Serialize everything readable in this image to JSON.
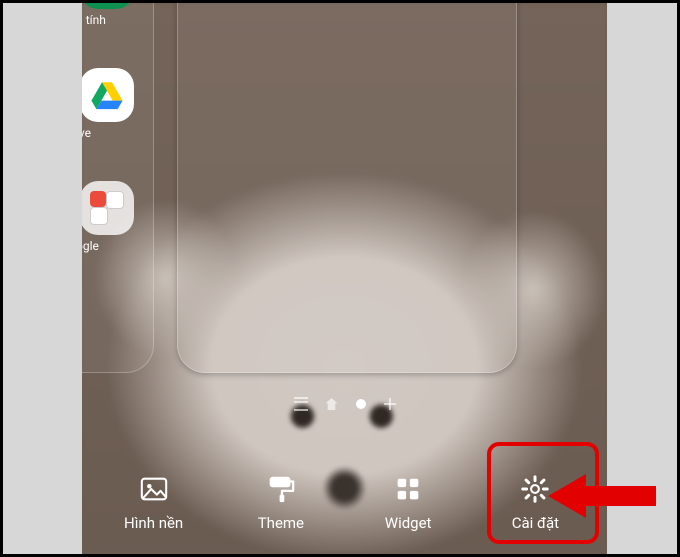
{
  "side_apps": {
    "sheets_label": "g tính",
    "drive_label": "ive",
    "folder_label": "ogle"
  },
  "actions": {
    "wallpaper": "Hình nền",
    "theme": "Theme",
    "widget": "Widget",
    "settings": "Cài đặt"
  },
  "icons": {
    "wallpaper": "image-icon",
    "theme": "paint-roller-icon",
    "widget": "grid-icon",
    "settings": "gear-icon",
    "sheets": "sheets-icon",
    "drive": "drive-icon",
    "folder": "folder-icon"
  },
  "annotation": {
    "highlight_target": "settings",
    "arrow_color": "#e30000"
  }
}
